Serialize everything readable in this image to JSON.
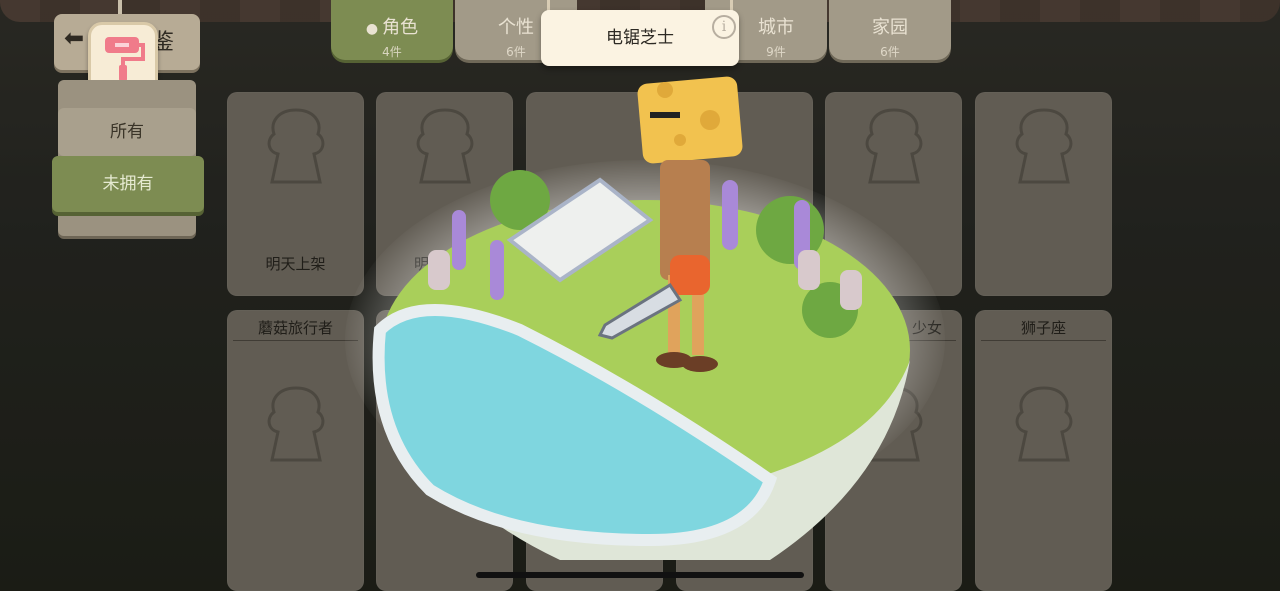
{
  "header": {
    "title": "鉴",
    "tabs": [
      {
        "label": "角色",
        "count": "4件",
        "active": true,
        "icon": "person-icon"
      },
      {
        "label": "个性",
        "count": "6件",
        "active": false
      },
      {
        "label": "城市",
        "count": "9件",
        "active": false
      },
      {
        "label": "家园",
        "count": "6件",
        "active": false
      }
    ]
  },
  "sidebar": {
    "badge_icon": "paint-roller-icon",
    "filters": [
      {
        "label": "所有",
        "selected": false
      },
      {
        "label": "未拥有",
        "selected": true
      }
    ]
  },
  "cards": [
    {
      "title": "",
      "note": "明天上架"
    },
    {
      "title": "",
      "note": "明"
    },
    {
      "title": "",
      "note": ""
    },
    {
      "title": "",
      "note": ""
    },
    {
      "title": "",
      "note": ""
    },
    {
      "title": "",
      "note": ""
    },
    {
      "title": "蘑菇旅行者",
      "note": ""
    },
    {
      "title": "",
      "note": ""
    },
    {
      "title": "",
      "note": ""
    },
    {
      "title": "",
      "note": ""
    },
    {
      "title": "少女",
      "note": ""
    },
    {
      "title": "狮子座",
      "note": ""
    }
  ],
  "popup": {
    "name": "电锯芝士",
    "info_icon": "info-icon",
    "info_glyph": "i"
  },
  "colors": {
    "active_green": "#7d8c52",
    "plate": "#fbf3e2",
    "water": "#7fd6df",
    "grass": "#a9cf5a",
    "cheese": "#f2c24f"
  }
}
